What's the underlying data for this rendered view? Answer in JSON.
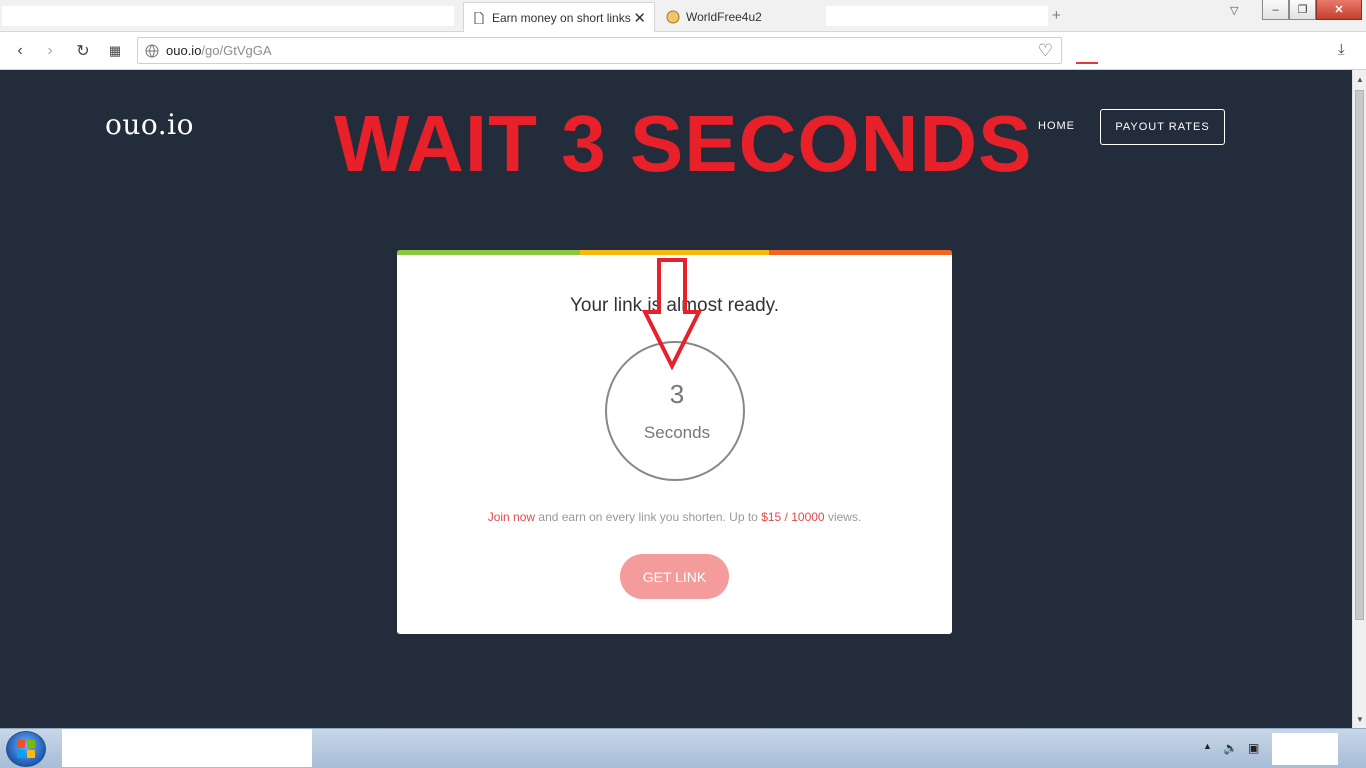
{
  "browser": {
    "tabs": [
      {
        "title": "Earn money on short links",
        "active": true,
        "icon": "page-icon"
      },
      {
        "title": "WorldFree4u2",
        "active": false,
        "icon": "site-icon"
      }
    ],
    "url_host": "ouo.io",
    "url_path": "/go/GtVgGA"
  },
  "page": {
    "logo": "ouo.io",
    "banner": "WAIT 3 SECONDS",
    "nav": {
      "home": "HOME",
      "payout": "PAYOUT RATES"
    },
    "card": {
      "ready_text": "Your link is almost ready.",
      "countdown_value": "3",
      "countdown_unit": "Seconds",
      "promo_join": "Join now",
      "promo_mid": " and earn on every link you shorten. Up to ",
      "promo_rate": "$15 / 10000",
      "promo_end": " views.",
      "button": "GET LINK"
    }
  },
  "colors": {
    "page_bg": "#232c3a",
    "accent_red": "#e8202a",
    "bar_green": "#8cc63f",
    "bar_yellow": "#f7b90f",
    "bar_orange": "#f26522",
    "button_pink": "#f49b9b"
  }
}
